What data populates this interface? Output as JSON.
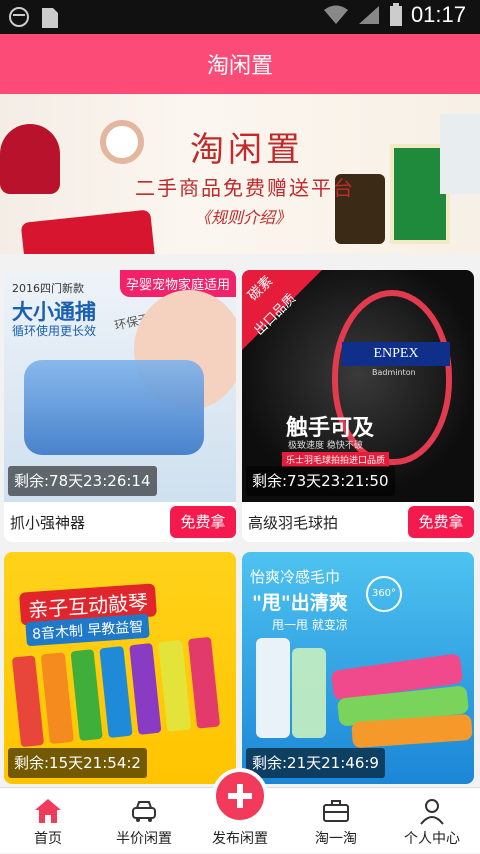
{
  "status_bar": {
    "time": "01:17"
  },
  "header": {
    "title": "淘闲置"
  },
  "banner": {
    "title": "淘闲置",
    "subtitle": "二手商品免费赠送平台",
    "link": "《规则介绍》"
  },
  "products": [
    {
      "image_text": {
        "tag": "孕婴宠物家庭适用",
        "year": "2016四门新款",
        "headline": "大小通捕",
        "sub": "循环使用更长效",
        "eco": "环保无毒"
      },
      "timer": "剩余:78天23:26:14",
      "name": "抓小强神器",
      "button": "免费拿"
    },
    {
      "image_text": {
        "badge1": "碳素",
        "badge2": "出口品质",
        "brand": "ENPEX",
        "model": "Badminton",
        "slogan": "触手可及",
        "detail": "极致速度 稳快不破",
        "note": "乐士羽毛球拍拍进口品质"
      },
      "timer": "剩余:73天23:21:50",
      "name": "高级羽毛球拍",
      "button": "免费拿"
    },
    {
      "image_text": {
        "headline": "亲子互动敲琴",
        "sub": "8音木制 早教益智"
      },
      "timer": "剩余:15天21:54:2"
    },
    {
      "image_text": {
        "title": "怡爽冷感毛巾",
        "slogan": "\"甩\"出清爽",
        "sub": "甩一甩  就变凉",
        "badge": "360°"
      },
      "timer": "剩余:21天21:46:9"
    }
  ],
  "tabbar": {
    "items": [
      {
        "label": "首页",
        "icon": "home-icon"
      },
      {
        "label": "半价闲置",
        "icon": "car-icon"
      },
      {
        "label": "发布闲置",
        "icon": "plus-icon"
      },
      {
        "label": "淘一淘",
        "icon": "briefcase-icon"
      },
      {
        "label": "个人中心",
        "icon": "user-icon"
      }
    ]
  },
  "colors": {
    "accent": "#fc4b77",
    "button": "#f41a4e",
    "home_active": "#f23a5a"
  }
}
